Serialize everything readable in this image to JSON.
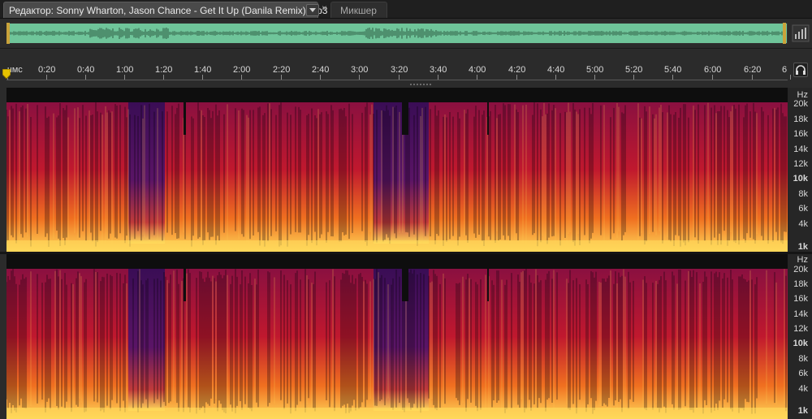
{
  "tabs": {
    "editor_label": "Редактор: Sonny Wharton, Jason Chance - Get It Up (Danila Remix).mp3",
    "close_glyph": "×",
    "mixer_label": "Микшер"
  },
  "ruler": {
    "labels": [
      "чмс",
      "0:20",
      "0:40",
      "1:00",
      "1:20",
      "1:40",
      "2:00",
      "2:20",
      "2:40",
      "3:00",
      "3:20",
      "3:40",
      "4:00",
      "4:20",
      "4:40",
      "5:00",
      "5:20",
      "5:40",
      "6:00",
      "6:20",
      "6"
    ]
  },
  "spectral": {
    "unit": "Hz",
    "labels": [
      "20k",
      "18k",
      "16k",
      "14k",
      "12k",
      "10k",
      "8k",
      "6k",
      "4k",
      "1k"
    ],
    "strong_labels": [
      "10k",
      "1k"
    ],
    "colors": {
      "background": "#0e0e0e",
      "low": "#ffd85a",
      "mid": "#f07020",
      "high": "#c0182e",
      "quiet": "#3a0d55"
    }
  },
  "icons": {
    "dropdown": "chevron-down-icon",
    "close": "close-icon",
    "zoom": "zoom-icon",
    "playhead": "playhead-icon",
    "monitor": "headphones-icon"
  }
}
